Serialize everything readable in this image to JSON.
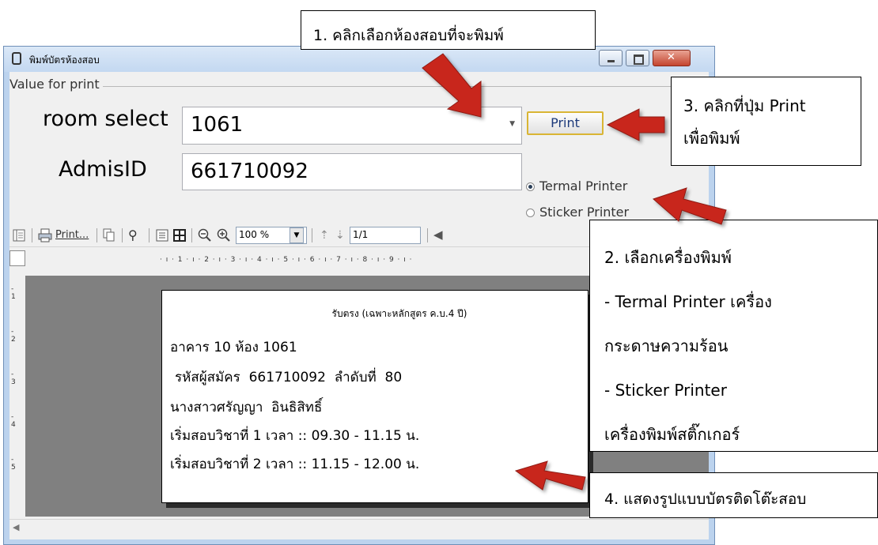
{
  "window": {
    "title": "พิมพ์บัตรห้องสอบ",
    "group_label": "Value for print",
    "room_label": "room select",
    "room_value": "1061",
    "admis_label": "AdmisID",
    "admis_value": "661710092",
    "print_button": "Print",
    "radio_termal": "Termal Printer",
    "radio_sticker": "Sticker Printer",
    "selected_printer": "Termal Printer"
  },
  "toolbar": {
    "print_label": "Print...",
    "zoom_value": "100 %",
    "page_value": "1/1"
  },
  "ruler": {
    "h_marks": [
      "1",
      "2",
      "3",
      "4",
      "5",
      "6",
      "7",
      "8",
      "9"
    ],
    "v_marks": [
      "1",
      "2",
      "3",
      "4",
      "5"
    ]
  },
  "card": {
    "header": "รับตรง (เฉพาะหลักสูตร ค.บ.4 ปี)",
    "line1": "อาคาร 10 ห้อง 1061",
    "line2": "รหัสผู้สมัคร  661710092  ลำดับที่  80",
    "line3": "นางสาวศรัญญา  อินธิสิทธิ์",
    "line4": "เริ่มสอบวิชาที่ 1 เวลา :: 09.30 - 11.15 น.",
    "line5": "เริ่มสอบวิชาที่ 2 เวลา :: 11.15 - 12.00 น."
  },
  "callouts": {
    "c1": "1. คลิกเลือกห้องสอบที่จะพิมพ์",
    "c3_line1": "3. คลิกที่ปุ่ม Print",
    "c3_line2": "เพื่อพิมพ์",
    "c2_line1": "2. เลือกเครื่องพิมพ์",
    "c2_line2": "- Termal Printer เครื่อง",
    "c2_line3": "กระดาษความร้อน",
    "c2_line4": "- Sticker Printer",
    "c2_line5": "เครื่องพิมพ์สติ๊กเกอร์",
    "c4": "4. แสดงรูปแบบบัตรติดโต๊ะสอบ"
  },
  "colors": {
    "arrow": "#c8281e",
    "window_frame": "#bcd3ee",
    "preview_bg": "#808080",
    "print_button_border": "#d9b534"
  },
  "icons": [
    "paperclip-icon",
    "minimize-icon",
    "maximize-icon",
    "close-icon",
    "page-toggle-icon",
    "printer-icon",
    "copy-icon",
    "binoculars-icon",
    "single-page-icon",
    "multi-page-icon",
    "zoom-out-icon",
    "zoom-in-icon",
    "prev-page-icon",
    "next-page-icon",
    "nav-icon"
  ]
}
